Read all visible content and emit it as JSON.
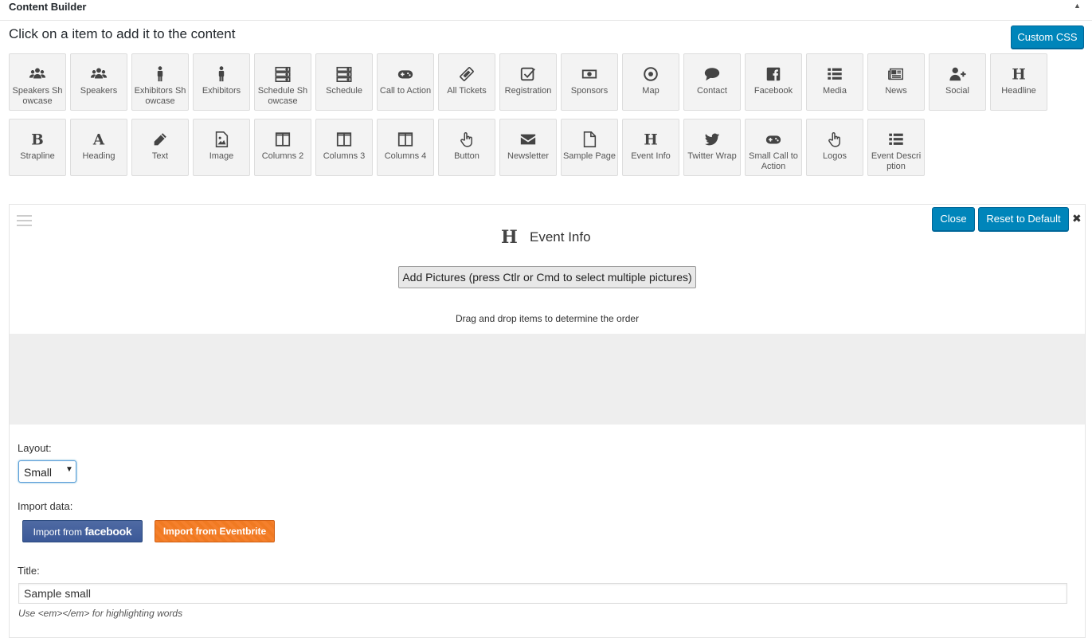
{
  "header": {
    "title": "Content Builder",
    "toggle_glyph": "▲"
  },
  "instruction": "Click on a item to add it to the content",
  "custom_css_label": "Custom CSS",
  "tiles": [
    {
      "label": "Speakers Showcase",
      "icon": "users-icon"
    },
    {
      "label": "Speakers",
      "icon": "users-icon"
    },
    {
      "label": "Exhibitors Showcase",
      "icon": "male-icon"
    },
    {
      "label": "Exhibitors",
      "icon": "male-icon"
    },
    {
      "label": "Schedule Showcase",
      "icon": "server-icon"
    },
    {
      "label": "Schedule",
      "icon": "server-icon"
    },
    {
      "label": "Call to Action",
      "icon": "gamepad-icon"
    },
    {
      "label": "All Tickets",
      "icon": "ticket-icon"
    },
    {
      "label": "Registration",
      "icon": "check-square-icon"
    },
    {
      "label": "Sponsors",
      "icon": "money-icon"
    },
    {
      "label": "Map",
      "icon": "dot-circle-icon"
    },
    {
      "label": "Contact",
      "icon": "comment-icon"
    },
    {
      "label": "Facebook",
      "icon": "facebook-icon"
    },
    {
      "label": "Media",
      "icon": "list-icon"
    },
    {
      "label": "News",
      "icon": "newspaper-icon"
    },
    {
      "label": "Social",
      "icon": "user-plus-icon"
    },
    {
      "label": "Headline",
      "icon": "header-icon"
    },
    {
      "label": "Strapline",
      "icon": "bold-icon"
    },
    {
      "label": "Heading",
      "icon": "font-icon"
    },
    {
      "label": "Text",
      "icon": "pencil-icon"
    },
    {
      "label": "Image",
      "icon": "image-file-icon"
    },
    {
      "label": "Columns 2",
      "icon": "columns-icon"
    },
    {
      "label": "Columns 3",
      "icon": "columns-icon"
    },
    {
      "label": "Columns 4",
      "icon": "columns-icon"
    },
    {
      "label": "Button",
      "icon": "hand-pointer-icon"
    },
    {
      "label": "Newsletter",
      "icon": "envelope-icon"
    },
    {
      "label": "Sample Page",
      "icon": "file-icon"
    },
    {
      "label": "Event Info",
      "icon": "header-icon"
    },
    {
      "label": "Twitter Wrap",
      "icon": "twitter-icon"
    },
    {
      "label": "Small Call to Action",
      "icon": "gamepad-icon"
    },
    {
      "label": "Logos",
      "icon": "hand-pointer-icon"
    },
    {
      "label": "Event Description",
      "icon": "list-icon"
    }
  ],
  "panel": {
    "title": "Event Info",
    "title_icon": "H",
    "close_label": "Close",
    "reset_label": "Reset to Default",
    "close_x": "✖",
    "add_pictures_label": "Add Pictures (press Ctlr or Cmd to select multiple pictures)",
    "hint": "Drag and drop items to determine the order",
    "layout_label": "Layout:",
    "layout_value": "Small",
    "import_label": "Import data:",
    "import_fb_prefix": "Import from ",
    "import_fb_word": "facebook",
    "import_eventbrite_label": "Import from Eventbrite",
    "title_label": "Title:",
    "title_value": "Sample small",
    "title_desc": "Use <em></em> for highlighting words"
  },
  "colors": {
    "accent": "#0085ba",
    "facebook": "#3b5998",
    "eventbrite": "#f5802c"
  }
}
